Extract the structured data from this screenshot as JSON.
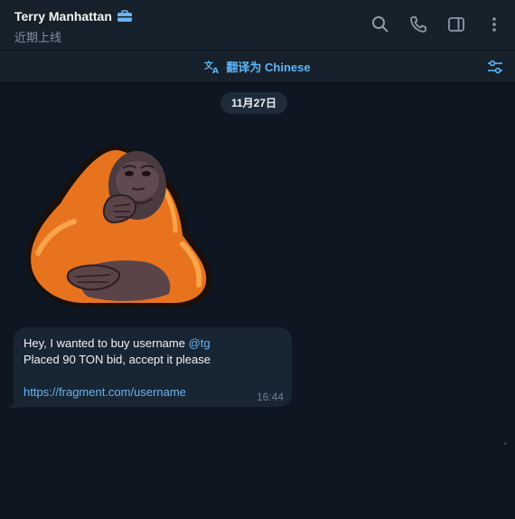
{
  "header": {
    "contact_name": "Terry Manhattan",
    "status": "近期上线",
    "icons": [
      "search-icon",
      "phone-icon",
      "sidebar-icon",
      "more-icon"
    ]
  },
  "translate_bar": {
    "label": "翻译为 Chinese",
    "icon": "translate-icon",
    "settings_icon": "settings-sliders-icon"
  },
  "chat": {
    "date": "11月27日",
    "message": {
      "line1_text": "Hey, I wanted to buy username ",
      "line1_mention": "@tg",
      "line2": "Placed 90 TON bid, accept it please",
      "link": "https://fragment.com/username",
      "time": "16:44"
    }
  },
  "colors": {
    "background": "#0e1621",
    "header": "#17212b",
    "bubble": "#182533",
    "accent": "#5eb5f7"
  }
}
